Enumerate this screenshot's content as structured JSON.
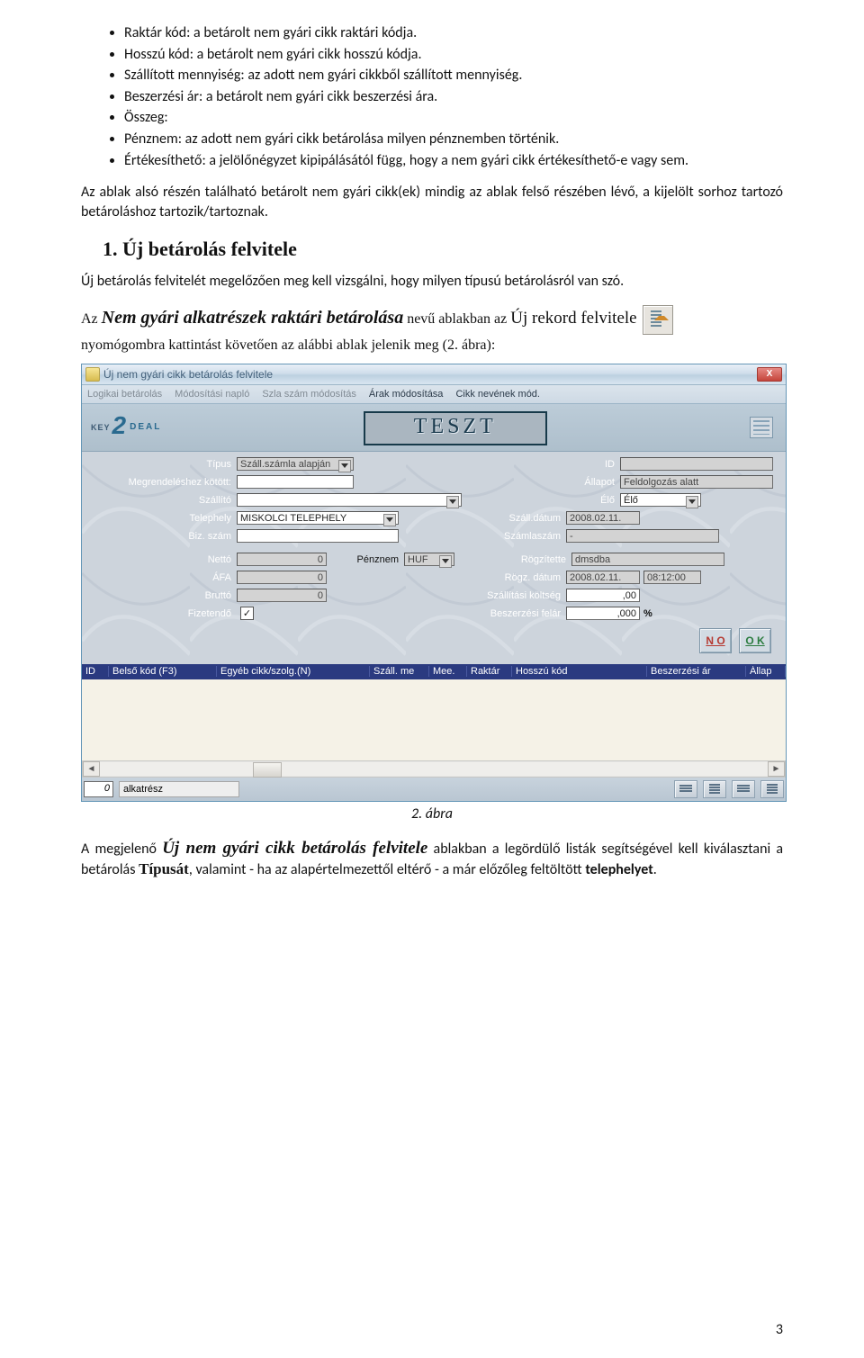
{
  "bullets": [
    "Raktár kód: a betárolt nem gyári cikk raktári kódja.",
    "Hosszú kód: a betárolt nem gyári cikk hosszú kódja.",
    "Szállított mennyiség: az adott nem gyári cikkből szállított mennyiség.",
    "Beszerzési ár: a betárolt nem gyári cikk beszerzési ára.",
    "Összeg:",
    "Pénznem: az adott nem gyári cikk betárolása milyen pénznemben történik.",
    "Értékesíthető: a jelölőnégyzet kipipálásától függ, hogy a nem gyári cikk értékesíthető-e vagy sem."
  ],
  "para1": "Az ablak alsó részén található betárolt nem gyári cikk(ek) mindig az ablak felső részében lévő, a kijelölt sorhoz tartozó betároláshoz tartozik/tartoznak.",
  "h2": "1. Új betárolás felvitele",
  "para2": "Új betárolás felvitelét megelőzően meg kell vizsgálni, hogy milyen típusú betárolásról van szó.",
  "pmix": {
    "pre": "Az ",
    "win": "Nem gyári alkatrészek raktári betárolása",
    "mid": " nevű ablakban az ",
    "act": "Új rekord felvitele",
    "post": " nyomógombra kattintást követően az alábbi ablak jelenik meg (2. ábra):"
  },
  "figcap": "2. ábra",
  "pafter": {
    "t1": "A megjelenő ",
    "win": "Új nem gyári cikk betárolás felvitele",
    "t2": " ablakban a legördülő listák segítségével kell kiválasztani a betárolás ",
    "b1": "Típusát",
    "t3": ", valamint - ha az alapértelmezettől eltérő - a már előzőleg feltöltött ",
    "b2": "telephelyet",
    "t4": "."
  },
  "pageno": "3",
  "win": {
    "title": "Új nem gyári cikk betárolás felvitele",
    "menu": [
      "Logikai betárolás",
      "Módosítási napló",
      "Szla szám módosítás",
      "Árak módosítása",
      "Cikk nevének mód."
    ],
    "menu_disabled": [
      0,
      1,
      2
    ],
    "teszt": "TESZT",
    "labels": {
      "tipus": "Típus",
      "id": "ID",
      "megrend": "Megrendeléshez kötött:",
      "allapot": "Állapot",
      "szallito": "Szállító",
      "elo": "Élő",
      "telephely": "Telephely",
      "szalldatum": "Száll.dátum",
      "bizszam": "Biz. szám",
      "szamlaszam": "Számlaszám",
      "netto": "Nettó",
      "penznem": "Pénznem",
      "rogzit": "Rögzítette",
      "afa": "ÁFA",
      "rogzd": "Rögz. dátum",
      "brutto": "Bruttó",
      "szkolt": "Szállítási költség",
      "fiz": "Fizetendő",
      "beszf": "Beszerzési felár",
      "pct": "%"
    },
    "vals": {
      "tipus": "Száll.számla alapján",
      "id": "",
      "allapot": "Feldolgozás alatt",
      "elo": "Élő",
      "telephely": "MISKOLCI TELEPHELY",
      "szalldatum": "2008.02.11.",
      "bizszam": "",
      "szamlaszam": "-",
      "netto": "0",
      "penznem": "HUF",
      "rogzit": "dmsdba",
      "afa": "0",
      "rogzd_d": "2008.02.11.",
      "rogzd_t": "08:12:00",
      "brutto": "0",
      "szkolt": ",00",
      "beszf": ",000",
      "fiz_chk": "✓"
    },
    "btns": {
      "no": "N O",
      "ok": "O K"
    },
    "grid_headers": [
      "ID",
      "Belső kód (F3)",
      "Egyéb cikk/szolg.(N)",
      "Száll. me",
      "Mee.",
      "Raktár",
      "Hosszú kód",
      "Beszerzési ár",
      "Állap"
    ],
    "status": {
      "count": "0",
      "label": "alkatrész"
    }
  }
}
